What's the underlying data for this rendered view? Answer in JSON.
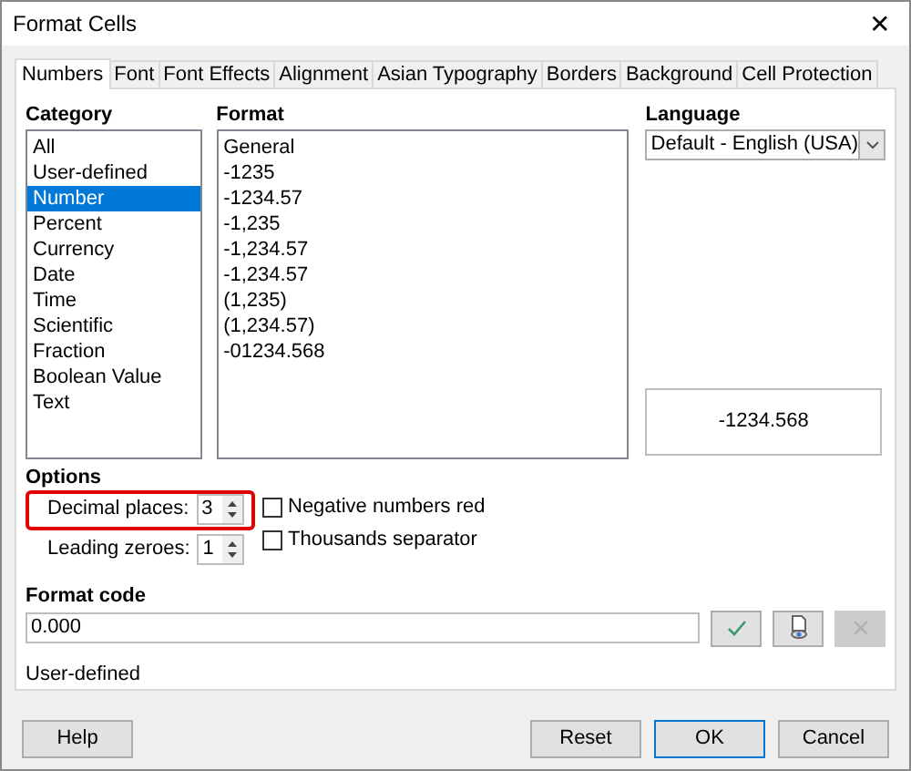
{
  "window": {
    "title": "Format Cells",
    "close": "✕"
  },
  "tabs": [
    {
      "label": "Numbers",
      "selected": true
    },
    {
      "label": "Font",
      "selected": false
    },
    {
      "label": "Font Effects",
      "selected": false
    },
    {
      "label": "Alignment",
      "selected": false
    },
    {
      "label": "Asian Typography",
      "selected": false
    },
    {
      "label": "Borders",
      "selected": false
    },
    {
      "label": "Background",
      "selected": false
    },
    {
      "label": "Cell Protection",
      "selected": false
    }
  ],
  "category": {
    "label": "Category",
    "items": [
      {
        "label": "All",
        "selected": false
      },
      {
        "label": "User-defined",
        "selected": false
      },
      {
        "label": "Number",
        "selected": true
      },
      {
        "label": "Percent",
        "selected": false
      },
      {
        "label": "Currency",
        "selected": false
      },
      {
        "label": "Date",
        "selected": false
      },
      {
        "label": "Time",
        "selected": false
      },
      {
        "label": "Scientific",
        "selected": false
      },
      {
        "label": "Fraction",
        "selected": false
      },
      {
        "label": "Boolean Value",
        "selected": false
      },
      {
        "label": "Text",
        "selected": false
      }
    ]
  },
  "format": {
    "label": "Format",
    "items": [
      {
        "label": "General",
        "selected": false
      },
      {
        "label": "-1235",
        "selected": false
      },
      {
        "label": "-1234.57",
        "selected": false
      },
      {
        "label": "-1,235",
        "selected": false
      },
      {
        "label": "-1,234.57",
        "selected": false
      },
      {
        "label": "-1,234.57",
        "selected": false
      },
      {
        "label": "(1,235)",
        "selected": false
      },
      {
        "label": "(1,234.57)",
        "selected": false
      },
      {
        "label": "-01234.568",
        "selected": false
      }
    ]
  },
  "language": {
    "label": "Language",
    "value": "Default - English (USA)"
  },
  "preview": "-1234.568",
  "options": {
    "label": "Options",
    "spinners": [
      {
        "label": "Decimal places:",
        "value": "3",
        "highlighted": true
      },
      {
        "label": "Leading zeroes:",
        "value": "1",
        "highlighted": false
      }
    ],
    "checkboxes": [
      {
        "label": "Negative numbers red",
        "checked": false
      },
      {
        "label": "Thousands separator",
        "checked": false
      }
    ]
  },
  "format_code": {
    "label": "Format code",
    "value": "0.000",
    "buttons": [
      {
        "kind": "check",
        "disabled": false
      },
      {
        "kind": "comment",
        "disabled": false
      },
      {
        "kind": "delete",
        "disabled": true
      }
    ],
    "description": "User-defined"
  },
  "buttons": [
    {
      "label": "Help",
      "default": false
    },
    {
      "label": "Reset",
      "default": false
    },
    {
      "label": "OK",
      "default": true
    },
    {
      "label": "Cancel",
      "default": false
    }
  ]
}
